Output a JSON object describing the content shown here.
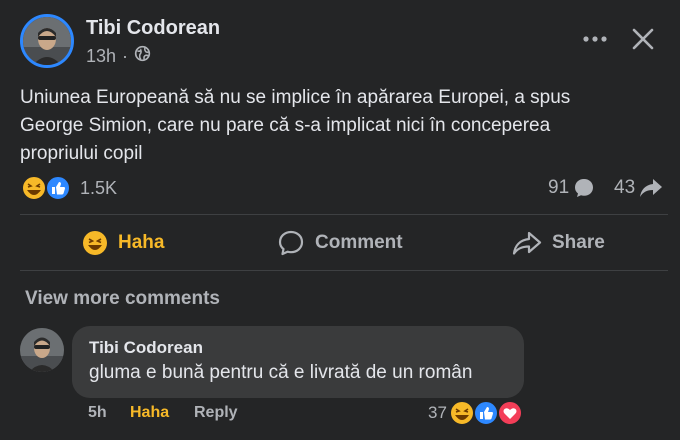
{
  "post": {
    "author": "Tibi Codorean",
    "time": "13h",
    "time_separator": "·",
    "text_line1": "Uniunea Europeană să nu se implice în apărarea Europei, a spus",
    "text_line2": "George Simion, care nu pare că s-a implicat nici în conceperea",
    "text_line3": "propriului copil"
  },
  "summary": {
    "reactions_count": "1.5K",
    "comments_count": "91",
    "shares_count": "43",
    "reaction_icons": [
      "haha-icon",
      "like-icon"
    ]
  },
  "actions": {
    "haha_label": "Haha",
    "comment_label": "Comment",
    "share_label": "Share"
  },
  "comments": {
    "view_more_label": "View more comments",
    "items": [
      {
        "author": "Tibi Codorean",
        "text": "gluma e bună pentru că e livrată de un român",
        "time": "5h",
        "reaction_label": "Haha",
        "reply_label": "Reply",
        "reaction_count": "37",
        "reaction_icons": [
          "haha-icon",
          "like-icon",
          "love-icon"
        ]
      }
    ]
  },
  "colors": {
    "background": "#242526",
    "primary_text": "#e4e6eb",
    "secondary_text": "#b0b3b8",
    "haha_accent": "#f7b928",
    "like_blue": "#2d88ff",
    "love_red": "#f33e58",
    "bubble": "#3a3b3c"
  }
}
